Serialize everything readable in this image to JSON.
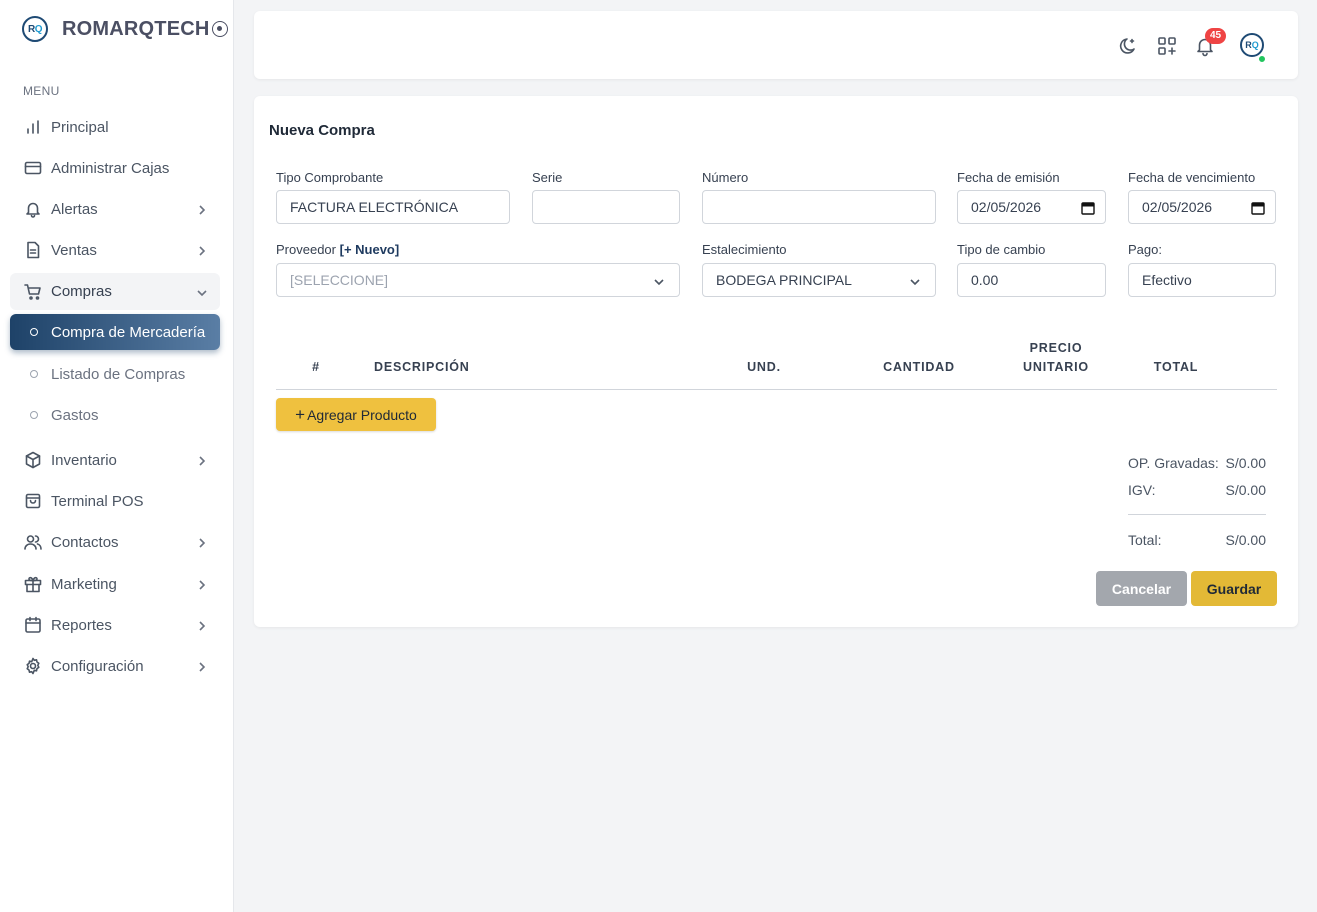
{
  "brand": {
    "name": "ROMARQTECH",
    "logo_r": "R",
    "logo_q": "Q"
  },
  "sidebar": {
    "menu_label": "MENU",
    "items": [
      {
        "label": "Principal",
        "icon": "chart-bars-icon"
      },
      {
        "label": "Administrar Cajas",
        "icon": "credit-card-icon"
      },
      {
        "label": "Alertas",
        "icon": "bell-icon"
      },
      {
        "label": "Ventas",
        "icon": "document-icon"
      },
      {
        "label": "Compras",
        "icon": "cart-icon"
      },
      {
        "label": "Inventario",
        "icon": "box-icon"
      },
      {
        "label": "Terminal POS",
        "icon": "shopping-bag-icon"
      },
      {
        "label": "Contactos",
        "icon": "users-icon"
      },
      {
        "label": "Marketing",
        "icon": "gift-icon"
      },
      {
        "label": "Reportes",
        "icon": "calendar-icon"
      },
      {
        "label": "Configuración",
        "icon": "gear-icon"
      }
    ],
    "sub_items": [
      {
        "label": "Compra de Mercadería",
        "active": true
      },
      {
        "label": "Listado de Compras",
        "active": false
      },
      {
        "label": "Gastos",
        "active": false
      }
    ]
  },
  "header": {
    "notification_count": "45",
    "avatar_r": "R",
    "avatar_q": "Q",
    "icons": [
      "moon-icon",
      "apps-icon",
      "bell-icon",
      "avatar"
    ]
  },
  "form": {
    "title": "Nueva Compra",
    "tipo_comprobante": {
      "label": "Tipo Comprobante",
      "value": "FACTURA ELECTRÓNICA"
    },
    "serie": {
      "label": "Serie",
      "value": ""
    },
    "numero": {
      "label": "Número",
      "value": ""
    },
    "fecha_emision": {
      "label": "Fecha de emisión",
      "value": "02/05/2026"
    },
    "fecha_vencimiento": {
      "label": "Fecha de vencimiento",
      "value": "02/05/2026"
    },
    "proveedor": {
      "label": "Proveedor",
      "new_link": "[+ Nuevo]",
      "placeholder": "[SELECCIONE]"
    },
    "establecimiento": {
      "label": "Estalecimiento",
      "value": "BODEGA PRINCIPAL"
    },
    "tipo_cambio": {
      "label": "Tipo de cambio",
      "value": "0.00"
    },
    "pago": {
      "label": "Pago:",
      "value": "Efectivo"
    }
  },
  "table": {
    "headers": [
      "#",
      "DESCRIPCIÓN",
      "UND.",
      "CANTIDAD",
      "PRECIO",
      "UNITARIO",
      "TOTAL"
    ],
    "add_button": "Agregar Producto"
  },
  "summary": {
    "op_gravadas_label": "OP. Gravadas:",
    "op_gravadas_value": "S/0.00",
    "igv_label": "IGV:",
    "igv_value": "S/0.00",
    "total_label": "Total:",
    "total_value": "S/0.00"
  },
  "actions": {
    "cancel": "Cancelar",
    "save": "Guardar"
  },
  "colors": {
    "primary": "#1e4268",
    "accent": "#efc13f",
    "badge": "#ef4444",
    "online": "#22c55e"
  }
}
